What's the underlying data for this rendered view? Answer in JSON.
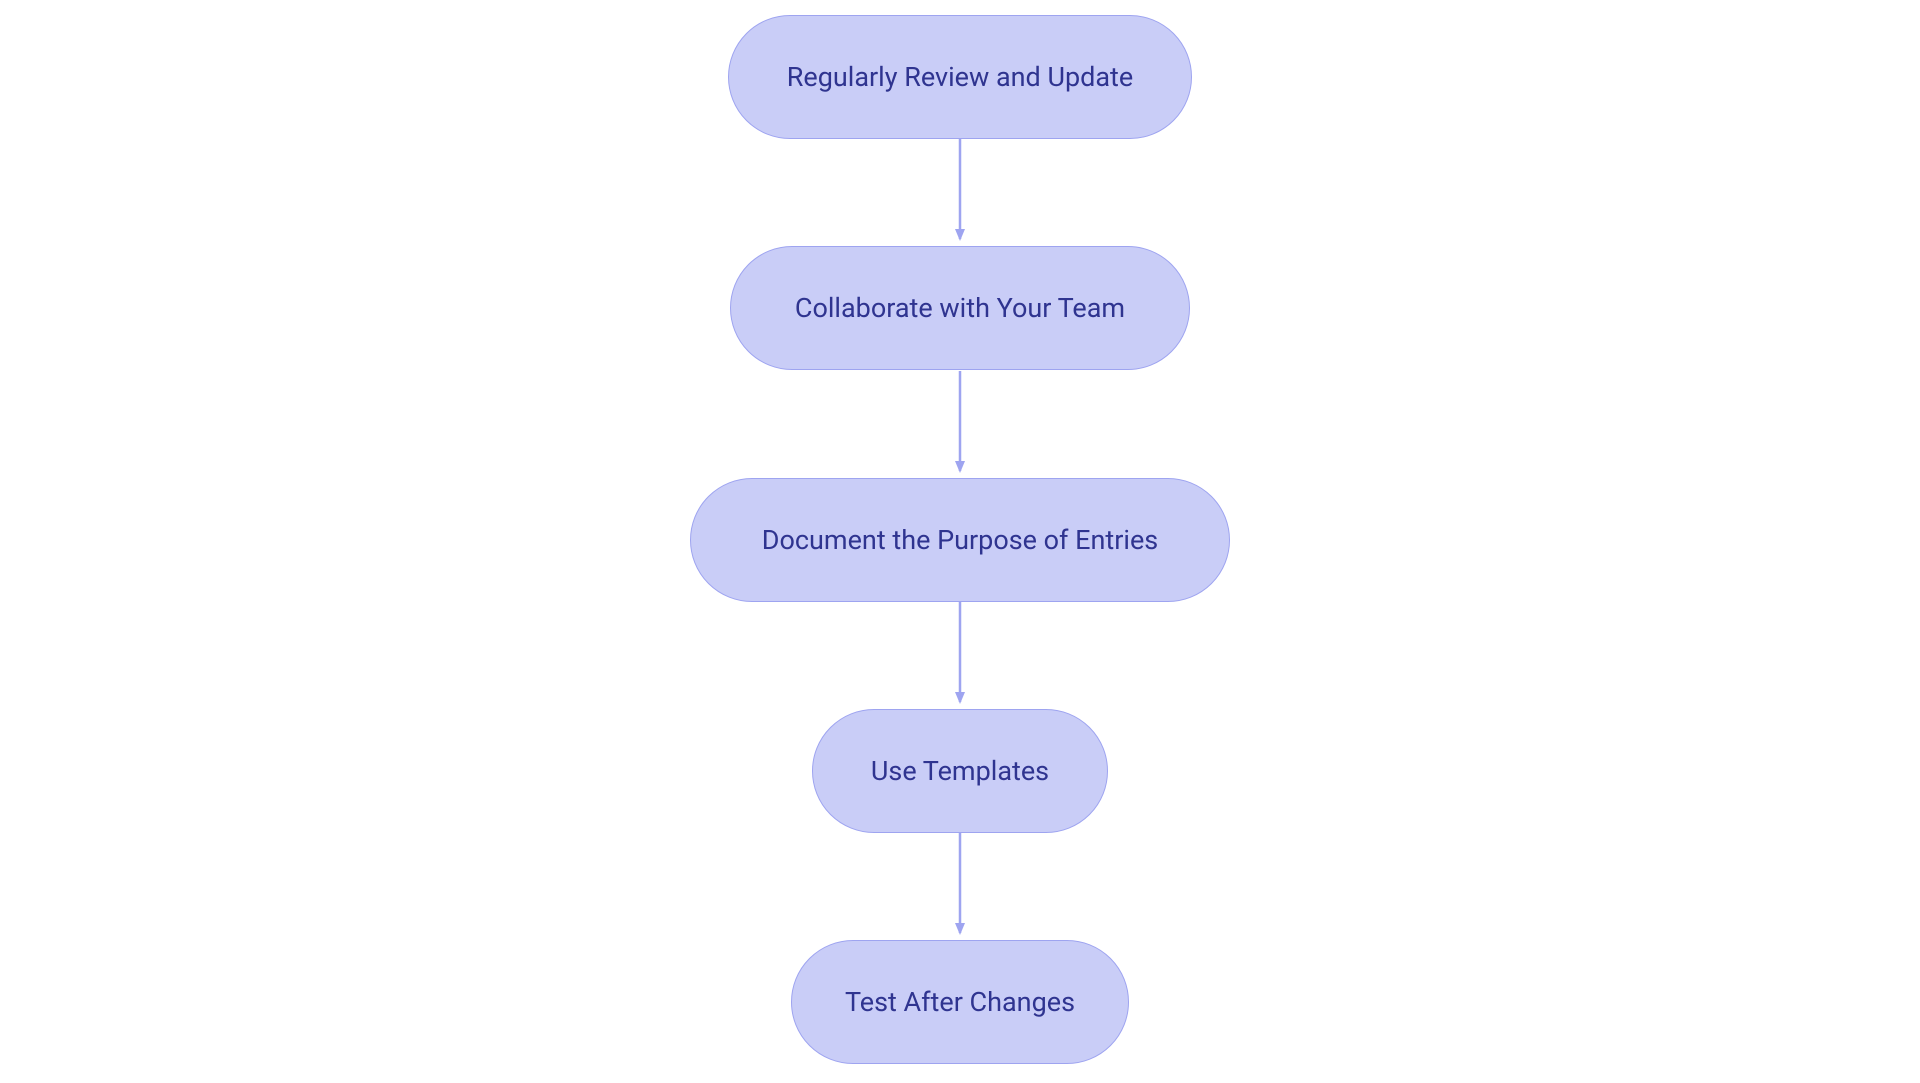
{
  "diagram": {
    "nodes": [
      {
        "id": "n1",
        "label": "Regularly Review and Update"
      },
      {
        "id": "n2",
        "label": "Collaborate with Your Team"
      },
      {
        "id": "n3",
        "label": "Document the Purpose of Entries"
      },
      {
        "id": "n4",
        "label": "Use Templates"
      },
      {
        "id": "n5",
        "label": "Test After Changes"
      }
    ],
    "edges": [
      {
        "from": "n1",
        "to": "n2"
      },
      {
        "from": "n2",
        "to": "n3"
      },
      {
        "from": "n3",
        "to": "n4"
      },
      {
        "from": "n4",
        "to": "n5"
      }
    ],
    "style": {
      "node_fill": "#c9cdf7",
      "node_stroke": "#9ea4f0",
      "node_text": "#2f3490",
      "arrow_color": "#9ea4f0"
    }
  }
}
